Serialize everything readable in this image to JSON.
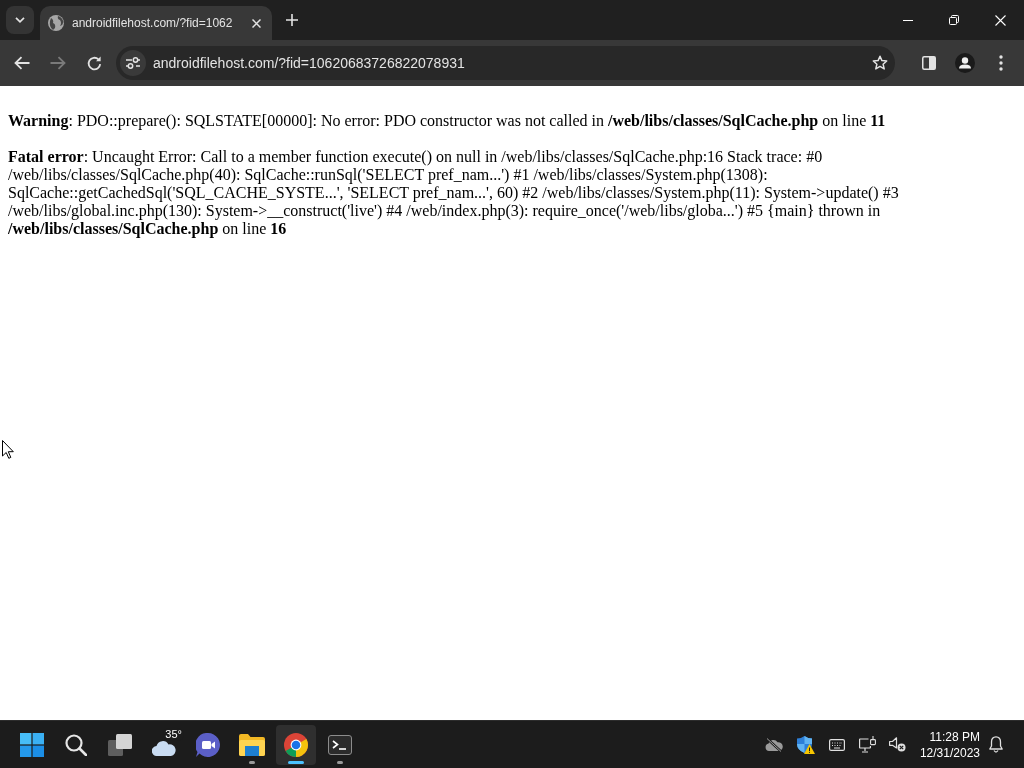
{
  "browser": {
    "tabs": [
      {
        "title": "androidfilehost.com/?fid=1062",
        "selected": true
      }
    ],
    "nav_buttons": [
      {
        "kind": "back",
        "disabled": false
      },
      {
        "kind": "forward",
        "disabled": true
      },
      {
        "kind": "reload",
        "disabled": false
      }
    ],
    "address_bar": {
      "url": "androidfilehost.com/?fid=10620683726822078931"
    }
  },
  "page": {
    "messages": [
      "**Warning**: PDO::prepare(): SQLSTATE[00000]: No error: PDO constructor was not called in **/web/libs/classes/SqlCache.php** on line **11**",
      "**Fatal error**: Uncaught Error: Call to a member function execute() on null in /web/libs/classes/SqlCache.php:16 Stack trace: #0 /web/libs/classes/SqlCache.php(40): SqlCache::runSql('SELECT pref_nam...') #1 /web/libs/classes/System.php(1308): SqlCache::getCachedSql('SQL_CACHE_SYSTE...', 'SELECT pref_nam...', 60) #2 /web/libs/classes/System.php(11): System->update() #3 /web/libs/global.inc.php(130): System->__construct('live') #4 /web/index.php(3): require_once('/web/libs/globa...') #5 {main} thrown in **/web/libs/classes/SqlCache.php** on line **16**"
    ]
  },
  "taskbar": {
    "apps": [
      {
        "kind": "start",
        "running": false,
        "selected": false
      },
      {
        "kind": "search",
        "running": false,
        "selected": false
      },
      {
        "kind": "task-view",
        "running": false,
        "selected": false
      },
      {
        "kind": "weather",
        "badge": "35°",
        "running": false,
        "selected": false
      },
      {
        "kind": "meet",
        "running": false,
        "selected": false
      },
      {
        "kind": "file-explorer",
        "running": true,
        "selected": false
      },
      {
        "kind": "browser",
        "running": true,
        "selected": true
      },
      {
        "kind": "terminal",
        "running": true,
        "selected": false
      }
    ],
    "clock": {
      "time": "11:28 PM",
      "date": "12/31/2023"
    }
  }
}
